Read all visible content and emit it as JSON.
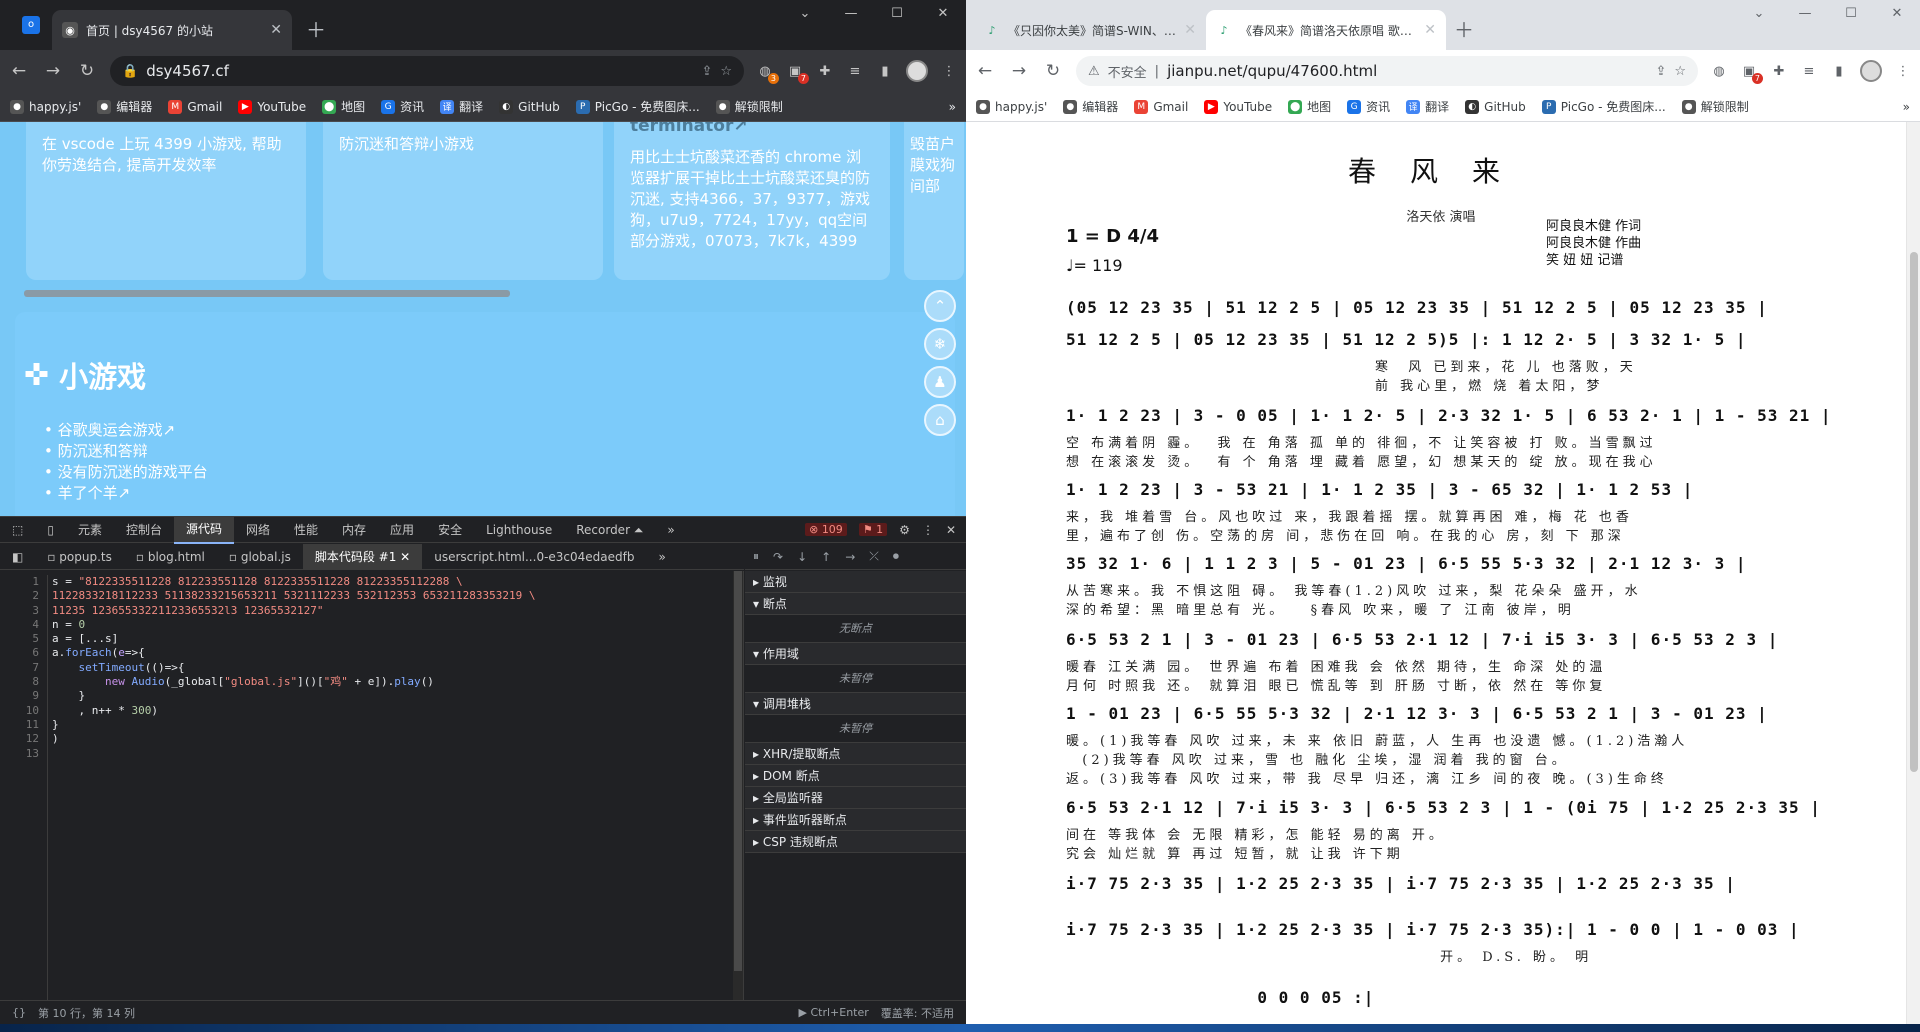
{
  "left_window": {
    "tab_title": "首页 | dsy4567 的小站",
    "url": "dsy4567.cf",
    "bookmarks": [
      "happy.js'",
      "编辑器",
      "Gmail",
      "YouTube",
      "地图",
      "资讯",
      "翻译",
      "GitHub",
      "PicGo - 免费图床...",
      "解锁限制"
    ],
    "ext_badge_1": "3",
    "ext_badge_2": "7",
    "cards": [
      {
        "title": "",
        "text": "在 vscode 上玩 4399 小游戏, 帮助你劳逸结合, 提高开发效率"
      },
      {
        "title": "",
        "text": "防沉迷和答辩小游戏"
      },
      {
        "title": "terminator↗",
        "text": "用比土士坑酸菜还香的 chrome 浏览器扩展干掉比土士坑酸菜还臭的防沉迷, 支持4366，37，9377，游戏狗，u7u9，7724，17yy，qq空间部分游戏，07073，7k7k，4399"
      },
      {
        "title": "",
        "text": "毁苗户膜戏狗间部"
      }
    ],
    "games_section_title": "小游戏",
    "games_list": [
      "谷歌奥运会游戏↗",
      "防沉迷和答辩",
      "没有防沉迷的游戏平台",
      "羊了个羊↗"
    ],
    "fab_icons": [
      "arrow-up-icon",
      "snowflake-icon",
      "bell-icon",
      "shirt-icon"
    ],
    "devtools": {
      "tabs": [
        "元素",
        "控制台",
        "源代码",
        "网络",
        "性能",
        "内存",
        "应用",
        "安全",
        "Lighthouse",
        "Recorder ⏶"
      ],
      "active_tab": "源代码",
      "error_count": "109",
      "issue_count": "1",
      "file_tabs": [
        "popup.ts",
        "blog.html",
        "global.js",
        "脚本代码段 #1",
        "userscript.html...0-e3c04edaedfb"
      ],
      "active_file": "脚本代码段 #1",
      "sidebar_sections": [
        "监视",
        "断点",
        "作用域",
        "调用堆栈",
        "XHR/提取断点",
        "DOM 断点",
        "全局监听器",
        "事件监听器断点",
        "CSP 违规断点"
      ],
      "no_breakpoints": "无断点",
      "not_paused_1": "未暂停",
      "not_paused_2": "未暂停",
      "status_position": "第 10 行，第 14 列",
      "status_run": "▶ Ctrl+Enter",
      "status_coverage": "覆盖率: 不适用"
    }
  },
  "right_window": {
    "tab1_title": "《只因你太美》简谱S-WIN、蔡...",
    "tab2_title": "《春风来》简谱洛天依原唱 歌谱...",
    "security": "不安全",
    "url": "jianpu.net/qupu/47600.html",
    "bookmarks": [
      "happy.js'",
      "编辑器",
      "Gmail",
      "YouTube",
      "地图",
      "资讯",
      "翻译",
      "GitHub",
      "PicGo - 免费图床...",
      "解锁限制"
    ],
    "score": {
      "title": "春风来",
      "subtitle": "洛天依 演唱",
      "key": "1 = D 4/4",
      "tempo": "♩= 119",
      "credit_lyrics": "阿良良木健  作词",
      "credit_music": "阿良良木健  作曲",
      "credit_notation": "笑   妞   妞  记谱"
    }
  }
}
